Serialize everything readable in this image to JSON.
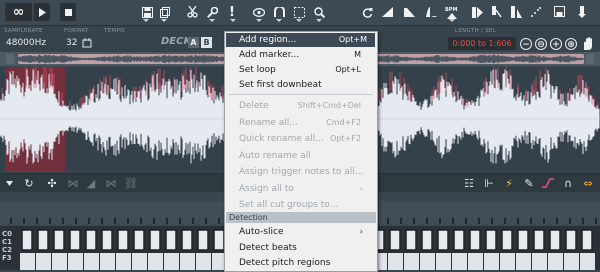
{
  "colors": {
    "accent": "#e4526a",
    "waveform": "#e5e9f0",
    "region": "#72303d",
    "menu_bg": "#f0f0f0",
    "menu_highlight": "#3d4a55"
  },
  "toolbar": {
    "loop_symbol": "∞",
    "icons": [
      "loop-icon",
      "play-icon",
      "stop-icon",
      "save-icon",
      "cut-icon",
      "tools-icon",
      "marker-icon",
      "view-icon",
      "snap-icon",
      "select-icon",
      "zoom-icon",
      "reload-icon",
      "envelope-icon",
      "curve-icon",
      "bpm-icon",
      "slice-icon",
      "chop-icon",
      "export-icon",
      "save-sample-icon",
      "drag-icon"
    ]
  },
  "info": {
    "samplerate_label": "SAMPLERATE",
    "samplerate_value": "48000Hz",
    "format_label": "FORMAT",
    "format_value": "32",
    "tempo_label": "TEMPO",
    "deck_label": "DECK",
    "deck_a": "A",
    "deck_b": "B",
    "length_label": "LENGTH / SEL",
    "length_value": "0:000 to 1:606"
  },
  "context_menu": {
    "items_top": [
      {
        "label": "Add region...",
        "shortcut": "Opt+M",
        "state": "highlighted"
      },
      {
        "label": "Add marker...",
        "shortcut": "M",
        "state": "enabled"
      },
      {
        "label": "Set loop",
        "shortcut": "Opt+L",
        "state": "enabled"
      },
      {
        "label": "Set first downbeat",
        "shortcut": "",
        "state": "enabled"
      }
    ],
    "items_mid": [
      {
        "label": "Delete",
        "shortcut": "Shift+Cmd+Del",
        "state": "disabled"
      },
      {
        "label": "Rename all...",
        "shortcut": "Cmd+F2",
        "state": "disabled"
      },
      {
        "label": "Quick rename all...",
        "shortcut": "Opt+F2",
        "state": "disabled"
      },
      {
        "label": "Auto rename all",
        "shortcut": "",
        "state": "disabled"
      },
      {
        "label": "Assign trigger notes to all...",
        "shortcut": "",
        "state": "disabled"
      },
      {
        "label": "Assign all to",
        "shortcut": "",
        "state": "disabled",
        "submenu": true
      },
      {
        "label": "Set all cut groups to...",
        "shortcut": "",
        "state": "disabled"
      }
    ],
    "section_detection": "Detection",
    "items_detection": [
      {
        "label": "Auto-slice",
        "shortcut": "",
        "state": "enabled",
        "submenu": true
      },
      {
        "label": "Detect beats",
        "shortcut": "",
        "state": "enabled"
      },
      {
        "label": "Detect pitch regions",
        "shortcut": "",
        "state": "enabled"
      }
    ]
  },
  "piano": {
    "octave_labels": [
      "C0",
      "C1",
      "C2",
      "F3"
    ]
  }
}
